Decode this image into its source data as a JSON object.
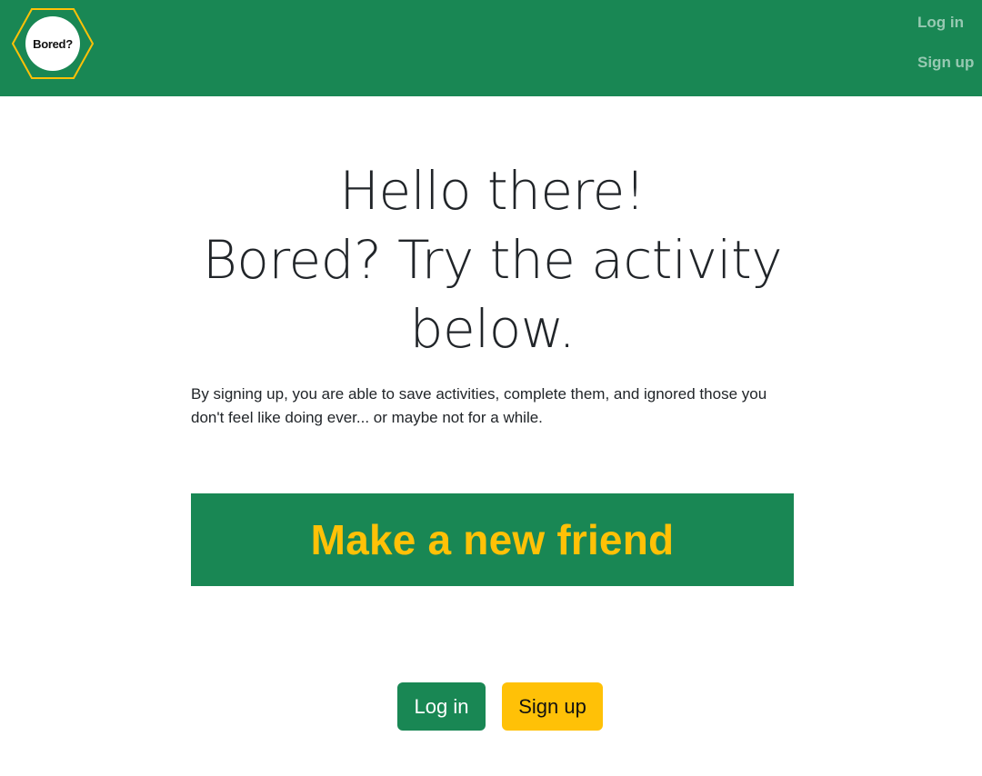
{
  "header": {
    "logo_text": "Bored?",
    "nav": {
      "login_label": "Log in",
      "signup_label": "Sign up"
    }
  },
  "hero": {
    "line1": "Hello there!",
    "line2": "Bored? Try the activity",
    "line3": "below."
  },
  "intro_text": "By signing up, you are able to save activities, complete them, and ignored those you don't feel like doing ever... or maybe not for a while.",
  "activity": {
    "text": "Make a new friend"
  },
  "actions": {
    "login_label": "Log in",
    "signup_label": "Sign up"
  },
  "colors": {
    "primary_green": "#198754",
    "accent_yellow": "#ffc107"
  }
}
